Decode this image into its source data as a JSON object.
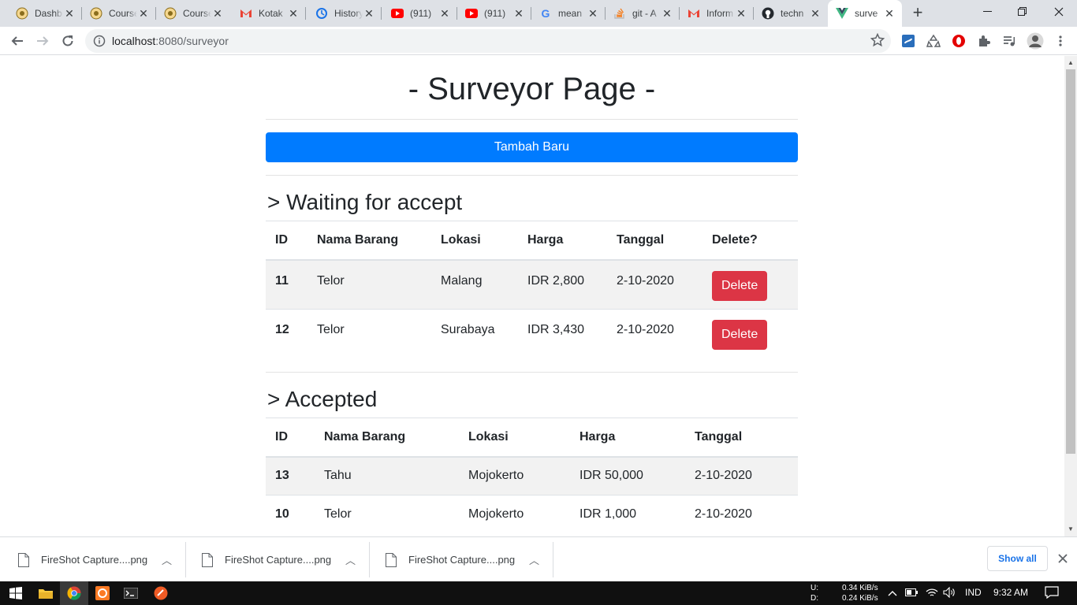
{
  "browser": {
    "tabs": [
      {
        "title": "Dashboard",
        "icon": "moodle-icon"
      },
      {
        "title": "Course",
        "icon": "moodle-icon"
      },
      {
        "title": "Course",
        "icon": "moodle-icon"
      },
      {
        "title": "Kotak",
        "icon": "gmail-icon"
      },
      {
        "title": "History",
        "icon": "history-icon"
      },
      {
        "title": "(911)",
        "icon": "youtube-icon"
      },
      {
        "title": "(911)",
        "icon": "youtube-icon"
      },
      {
        "title": "mean",
        "icon": "google-icon"
      },
      {
        "title": "git - A",
        "icon": "stackoverflow-icon"
      },
      {
        "title": "Inform",
        "icon": "gmail-icon"
      },
      {
        "title": "techn",
        "icon": "github-icon"
      },
      {
        "title": "surve",
        "icon": "vue-icon"
      }
    ],
    "active_tab_index": 11,
    "url_host": "localhost",
    "url_path": ":8080/surveyor"
  },
  "page": {
    "title": "- Surveyor Page -",
    "add_button": "Tambah Baru",
    "waiting": {
      "heading": "> Waiting for accept",
      "headers": [
        "ID",
        "Nama Barang",
        "Lokasi",
        "Harga",
        "Tanggal",
        "Delete?"
      ],
      "rows": [
        {
          "id": "11",
          "nama": "Telor",
          "lokasi": "Malang",
          "harga": "IDR 2,800",
          "tanggal": "2-10-2020",
          "action": "Delete"
        },
        {
          "id": "12",
          "nama": "Telor",
          "lokasi": "Surabaya",
          "harga": "IDR 3,430",
          "tanggal": "2-10-2020",
          "action": "Delete"
        }
      ]
    },
    "accepted": {
      "heading": "> Accepted",
      "headers": [
        "ID",
        "Nama Barang",
        "Lokasi",
        "Harga",
        "Tanggal"
      ],
      "rows": [
        {
          "id": "13",
          "nama": "Tahu",
          "lokasi": "Mojokerto",
          "harga": "IDR 50,000",
          "tanggal": "2-10-2020"
        },
        {
          "id": "10",
          "nama": "Telor",
          "lokasi": "Mojokerto",
          "harga": "IDR 1,000",
          "tanggal": "2-10-2020"
        }
      ]
    }
  },
  "downloads": {
    "items": [
      "FireShot Capture....png",
      "FireShot Capture....png",
      "FireShot Capture....png"
    ],
    "show_all": "Show all"
  },
  "taskbar": {
    "upload_label": "U:",
    "download_label": "D:",
    "upload_speed": "0.34 KiB/s",
    "download_speed": "0.24 KiB/s",
    "language": "IND",
    "time": "9:32 AM"
  },
  "colors": {
    "primary": "#007bff",
    "danger": "#dc3545",
    "striped_row": "#f2f2f2",
    "tabstrip": "#dee1e6"
  }
}
